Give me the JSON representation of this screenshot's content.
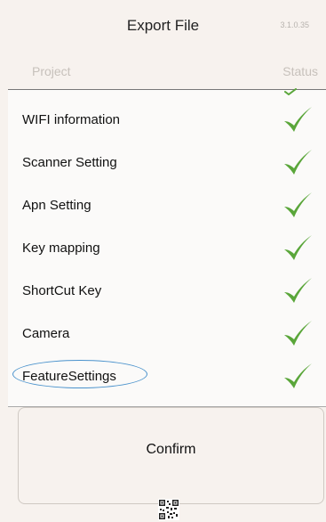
{
  "header": {
    "title": "Export File",
    "version": "3.1.0.35"
  },
  "columns": {
    "project": "Project",
    "status": "Status"
  },
  "items": [
    {
      "label": "WIFI information",
      "status": "checked"
    },
    {
      "label": "Scanner Setting",
      "status": "checked"
    },
    {
      "label": "Apn Setting",
      "status": "checked"
    },
    {
      "label": "Key mapping",
      "status": "checked"
    },
    {
      "label": "ShortCut Key",
      "status": "checked"
    },
    {
      "label": "Camera",
      "status": "checked"
    },
    {
      "label": "FeatureSettings",
      "status": "checked"
    }
  ],
  "confirm_label": "Confirm",
  "colors": {
    "background": "#f7f2ee",
    "check": "#5aa63a",
    "highlight_circle": "#4a92cc"
  },
  "icons": {
    "status": "checkmark-icon",
    "footer": "qr-code-icon"
  }
}
